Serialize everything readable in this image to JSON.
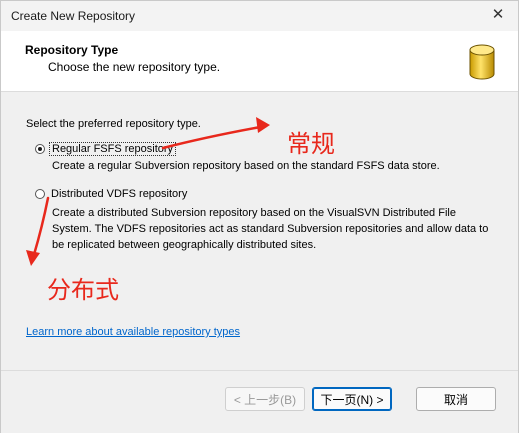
{
  "window": {
    "title": "Create New Repository",
    "close_glyph": "✕"
  },
  "header": {
    "title": "Repository Type",
    "subtitle": "Choose the new repository type.",
    "icon": "database-icon"
  },
  "content": {
    "prompt": "Select the preferred repository type.",
    "options": [
      {
        "label": "Regular FSFS repository",
        "description_lines": [
          "Create a regular Subversion repository based on the standard FSFS data store."
        ],
        "selected": true
      },
      {
        "label": "Distributed VDFS repository",
        "description_lines": [
          "Create a distributed Subversion repository based on the VisualSVN Distributed File",
          "System. The VDFS repositories act as standard Subversion repositories and allow data to",
          "be replicated between geographically distributed sites."
        ],
        "selected": false
      }
    ],
    "learn_more_link": "Learn more about available repository types"
  },
  "annotations": {
    "regular": "常规",
    "distributed": "分布式",
    "color": "#e8281c"
  },
  "buttons": {
    "back": "< 上一步(B)",
    "next": "下一页(N) >",
    "cancel": "取消"
  }
}
